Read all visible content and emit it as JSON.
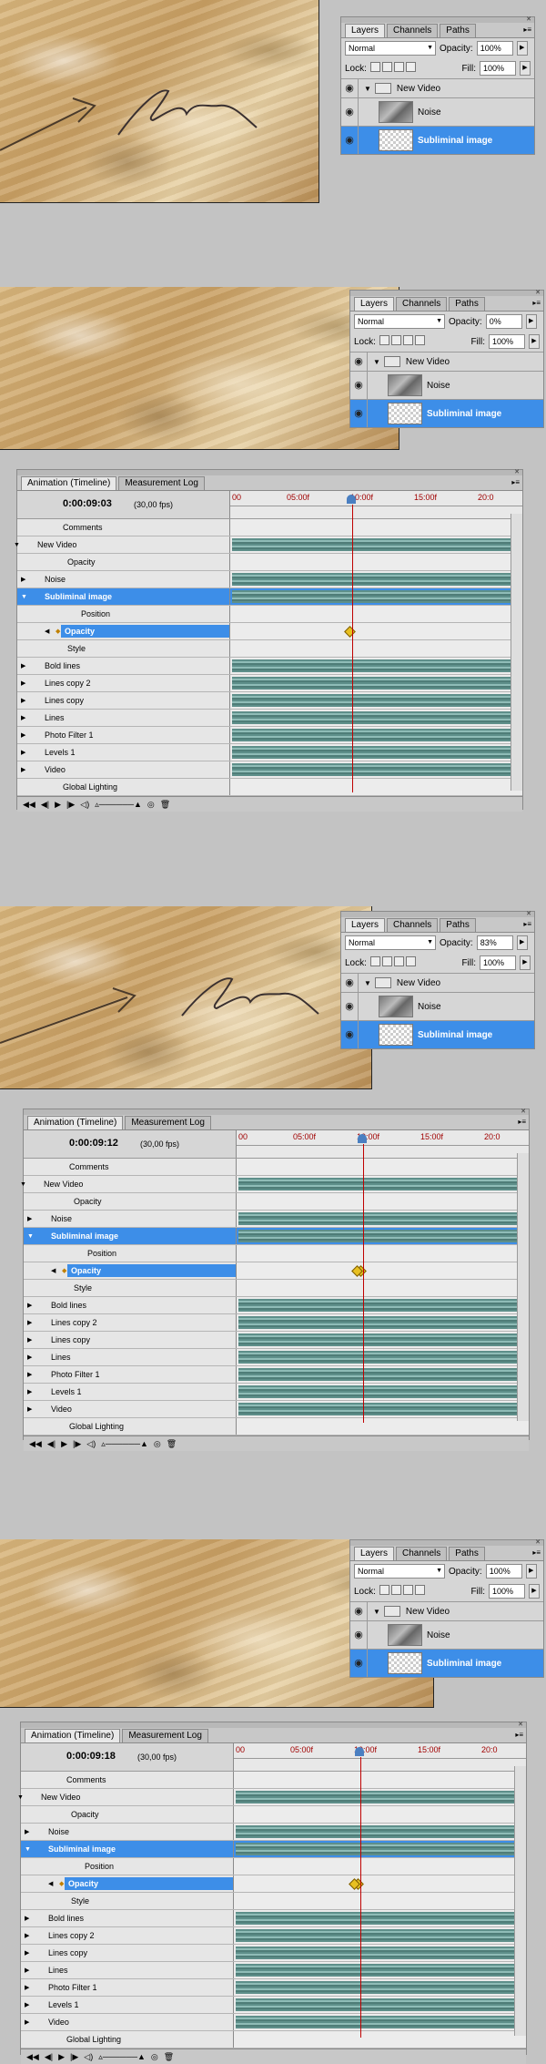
{
  "layers_panel": {
    "tabs": [
      "Layers",
      "Channels",
      "Paths"
    ],
    "blend_mode": "Normal",
    "opacity_label": "Opacity:",
    "lock_label": "Lock:",
    "fill_label": "Fill:",
    "fill_value": "100%",
    "group_name": "New Video",
    "layer_noise": "Noise",
    "layer_selected": "Subliminal image"
  },
  "timeline_panel": {
    "tabs": [
      "Animation (Timeline)",
      "Measurement Log"
    ],
    "fps": "(30,00 fps)",
    "ruler_labels": [
      "00",
      "05:00f",
      "10:00f",
      "15:00f",
      "20:0"
    ],
    "tracks": [
      "Comments",
      "New Video",
      "Opacity",
      "Noise",
      "Subliminal image",
      "Position",
      "Opacity",
      "Style",
      "Bold lines",
      "Lines copy 2",
      "Lines copy",
      "Lines",
      "Photo Filter 1",
      "Levels 1",
      "Video",
      "Global Lighting"
    ]
  },
  "frames": [
    {
      "opacity": "100%",
      "timecode": null
    },
    {
      "opacity": "0%",
      "timecode": "0:00:09:03"
    },
    {
      "opacity": "83%",
      "timecode": "0:00:09:12"
    },
    {
      "opacity": "100%",
      "timecode": "0:00:09:18"
    }
  ],
  "colors": {
    "selection": "#3d8ee8",
    "playhead": "#c00000",
    "track": "#5e8f8a",
    "keyframe": "#e8c020"
  }
}
